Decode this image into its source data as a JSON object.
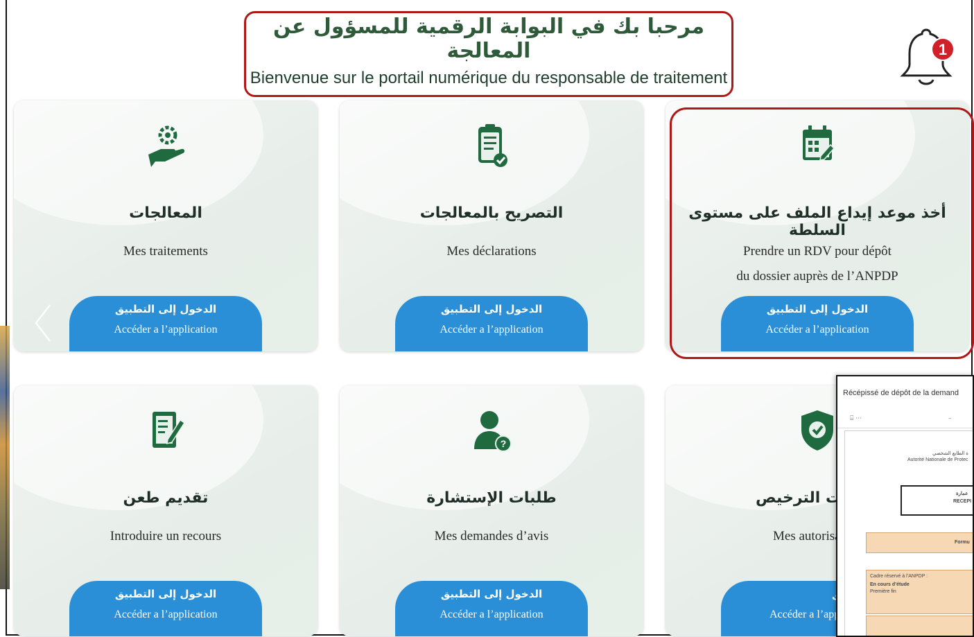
{
  "header": {
    "title_ar": "مرحبا بك في البوابة الرقمية للمسؤول عن المعالجة",
    "title_fr": "Bienvenue sur le portail numérique du responsable de traitement"
  },
  "notifications": {
    "icon": "bell-icon",
    "count": "1",
    "badge_color": "#d0202a"
  },
  "colors": {
    "accent": "#2a8fd6",
    "icon_green": "#1f6b3f",
    "highlight": "#b01818"
  },
  "cards": [
    {
      "icon": "gear-hand-icon",
      "title_ar": "المعالجات",
      "title_fr": [
        "Mes traitements",
        ""
      ],
      "cta_ar": "الدخول إلى التطبيق",
      "cta_fr": "Accéder a l’application"
    },
    {
      "icon": "clipboard-check-icon",
      "title_ar": "التصريح بالمعالجات",
      "title_fr": [
        "Mes déclarations",
        ""
      ],
      "cta_ar": "الدخول إلى التطبيق",
      "cta_fr": "Accéder a l’application"
    },
    {
      "icon": "calendar-edit-icon",
      "title_ar": "أخذ موعد إيداع الملف على مستوى السلطة",
      "title_fr": [
        "Prendre un RDV pour dépôt",
        "du dossier auprès de l’ANPDP"
      ],
      "cta_ar": "الدخول إلى التطبيق",
      "cta_fr": "Accéder a l’application"
    },
    {
      "icon": "document-edit-icon",
      "title_ar": "تقديم طعن",
      "title_fr": [
        "Introduire un recours",
        ""
      ],
      "cta_ar": "الدخول إلى التطبيق",
      "cta_fr": "Accéder a l’application"
    },
    {
      "icon": "user-question-icon",
      "title_ar": "طلبات الإستشارة",
      "title_fr": [
        "Mes demandes d’avis",
        ""
      ],
      "cta_ar": "الدخول إلى التطبيق",
      "cta_fr": "Accéder a l’application"
    },
    {
      "icon": "shield-check-icon",
      "title_ar": "ت الترخيص",
      "title_fr": [
        "Mes autorisa",
        ""
      ],
      "cta_ar": "ل إلى التطبيق",
      "cta_fr": "Accéder a l’app"
    }
  ],
  "document_preview": {
    "title": "Récépissé de dépôt de la demand",
    "header_ar": "ة الطابع الشخصي",
    "header_fr": "Autorité Nationale de Protec",
    "box_ar": "عمارة",
    "box_fr": "RECEPI",
    "form_label": "Formu",
    "reserved_label": "Cadre réservé à l’ANPDP :",
    "status_1": "En cours d’étude",
    "status_2": "Première fin"
  }
}
